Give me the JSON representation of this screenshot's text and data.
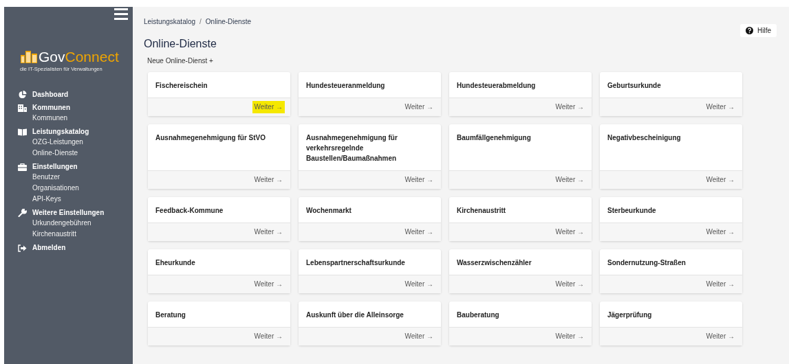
{
  "sidebar": {
    "logo": {
      "name_part_1": "Gov",
      "name_part_2": "Connect",
      "tagline": "die IT-Spezialisten für Verwaltungen"
    },
    "sections": [
      {
        "label": "Dashboard"
      },
      {
        "label": "Kommunen",
        "children": [
          "Kommunen"
        ]
      },
      {
        "label": "Leistungskatalog",
        "children": [
          "OZG-Leistungen",
          "Online-Dienste"
        ]
      },
      {
        "label": "Einstellungen",
        "children": [
          "Benutzer",
          "Organisationen",
          "API-Keys"
        ]
      },
      {
        "label": "Weitere Einstellungen",
        "children": [
          "Urkundengebühren",
          "Kirchenaustritt"
        ]
      },
      {
        "label": "Abmelden"
      }
    ]
  },
  "breadcrumb": {
    "items": [
      "Leistungskatalog",
      "Online-Dienste"
    ],
    "separator": "/"
  },
  "help_button": "Hilfe",
  "page_title": "Online-Dienste",
  "new_link": "Neue Online-Dienst +",
  "cards": [
    {
      "title": "Fischereischein",
      "action": "Weiter →",
      "highlighted": true
    },
    {
      "title": "Hundesteueranmeldung",
      "action": "Weiter →",
      "highlighted": false
    },
    {
      "title": "Hundesteuerabmeldung",
      "action": "Weiter →",
      "highlighted": false
    },
    {
      "title": "Geburtsurkunde",
      "action": "Weiter →",
      "highlighted": false
    },
    {
      "title": "Ausnahmegenehmigung für StVO",
      "action": "Weiter →",
      "highlighted": false
    },
    {
      "title": "Ausnahmegenehmigung für verkehrsregelnde Baustellen/Baumaßnahmen",
      "action": "Weiter →",
      "highlighted": false
    },
    {
      "title": "Baumfällgenehmigung",
      "action": "Weiter →",
      "highlighted": false
    },
    {
      "title": "Negativbescheinigung",
      "action": "Weiter →",
      "highlighted": false
    },
    {
      "title": "Feedback-Kommune",
      "action": "Weiter →",
      "highlighted": false
    },
    {
      "title": "Wochenmarkt",
      "action": "Weiter →",
      "highlighted": false
    },
    {
      "title": "Kirchenaustritt",
      "action": "Weiter →",
      "highlighted": false
    },
    {
      "title": "Sterbeurkunde",
      "action": "Weiter →",
      "highlighted": false
    },
    {
      "title": "Eheurkunde",
      "action": "Weiter →",
      "highlighted": false
    },
    {
      "title": "Lebenspartnerschaftsurkunde",
      "action": "Weiter →",
      "highlighted": false
    },
    {
      "title": "Wasserzwischenzähler",
      "action": "Weiter →",
      "highlighted": false
    },
    {
      "title": "Sondernutzung-Straßen",
      "action": "Weiter →",
      "highlighted": false
    },
    {
      "title": "Beratung",
      "action": "Weiter →",
      "highlighted": false
    },
    {
      "title": "Auskunft über die Alleinsorge",
      "action": "Weiter →",
      "highlighted": false
    },
    {
      "title": "Bauberatung",
      "action": "Weiter →",
      "highlighted": false
    },
    {
      "title": "Jägerprüfung",
      "action": "Weiter →",
      "highlighted": false
    }
  ]
}
